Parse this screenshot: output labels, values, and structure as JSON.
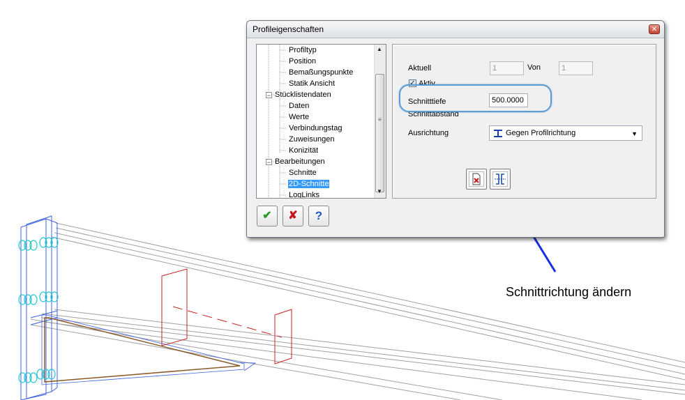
{
  "dialog": {
    "title": "Profileigenschaften",
    "close_glyph": "✕"
  },
  "tree": {
    "items": [
      {
        "label": "Profiltyp"
      },
      {
        "label": "Position"
      },
      {
        "label": "Bemaßungspunkte"
      },
      {
        "label": "Statik Ansicht"
      },
      {
        "label": "Stücklistendaten"
      },
      {
        "label": "Daten"
      },
      {
        "label": "Werte"
      },
      {
        "label": "Verbindungstag"
      },
      {
        "label": "Zuweisungen"
      },
      {
        "label": "Konizität"
      },
      {
        "label": "Bearbeitungen"
      },
      {
        "label": "Schnitte"
      },
      {
        "label": "2D-Schnitte"
      },
      {
        "label": "LogLinks"
      }
    ],
    "selected": "2D-Schnitte",
    "expander_glyph": "−"
  },
  "panel": {
    "aktuell_label": "Aktuell",
    "aktuell_value": "1",
    "von_label": "Von",
    "von_value": "1",
    "aktiv_label": "Aktiv",
    "aktiv_checked": true,
    "schnitttiefe_label": "Schnitttiefe",
    "schnitttiefe_value": "500.0000",
    "schnittabstand_label": "Schnittabstand",
    "ausrichtung_label": "Ausrichtung",
    "ausrichtung_value": "Gegen Profilrichtung"
  },
  "buttons": {
    "ok_glyph": "✔",
    "cancel_glyph": "✘",
    "help_glyph": "?"
  },
  "annotation": {
    "text": "Schnittrichtung ändern"
  },
  "icons": [
    "close-icon",
    "delete-cut-icon",
    "flip-direction-icon",
    "profile-icon",
    "checkmark-icon",
    "cancel-x-icon",
    "help-icon"
  ],
  "colors": {
    "arrow": "#1a2fe6",
    "highlight": "#5b9bd5",
    "selection": "#3399ff",
    "cut_plane": "#cc2222",
    "bolts": "#22c6d4",
    "beam_lines": "#9a9a9a",
    "beam_blue": "#3f63e0",
    "brown": "#8b5a2b"
  }
}
